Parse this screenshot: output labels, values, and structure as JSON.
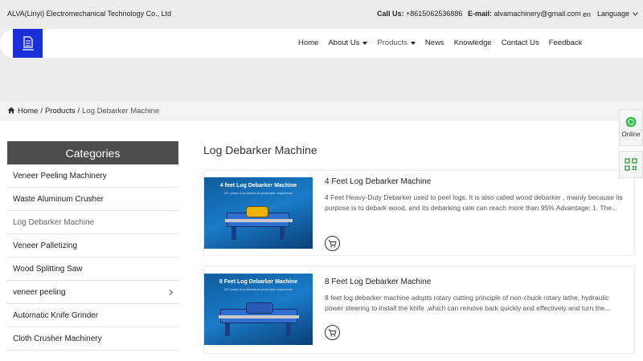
{
  "topbar": {
    "company": "ALVA(Linyi) Electromechanical Technology Co., Ltd",
    "tel_label": "Call Us:",
    "tel_value": "+8615062536886",
    "mail_label": "E-mail:",
    "mail_value": "alvamachinery@gmail.com",
    "lang_code": "en",
    "lang_label": "Language"
  },
  "nav": {
    "items": [
      {
        "label": "Home"
      },
      {
        "label": "About Us"
      },
      {
        "label": "Products"
      },
      {
        "label": "News"
      },
      {
        "label": "Knowledge"
      },
      {
        "label": "Contact Us"
      },
      {
        "label": "Feedback"
      }
    ]
  },
  "breadcrumb": {
    "home": "Home",
    "sep": "/",
    "products": "Products",
    "current": "Log Debarker Machine"
  },
  "sidebar": {
    "title": "Categories",
    "items": [
      {
        "label": "Veneer Peeling Machinery"
      },
      {
        "label": "Waste Aluminum Crusher"
      },
      {
        "label": "Log Debarker Machine"
      },
      {
        "label": "Veneer Palletizing"
      },
      {
        "label": "Wood Splitting Saw"
      },
      {
        "label": "veneer peeling"
      },
      {
        "label": "Automatic Knife Grinder"
      },
      {
        "label": "Cloth Crusher Machinery"
      }
    ]
  },
  "main": {
    "heading": "Log Debarker Machine",
    "products": [
      {
        "thumb_title": "4 feet Log Debarker Machine",
        "thumb_sub": "15+ years of professional production experience",
        "title": "4 Feet Log Debarker Machine",
        "desc": "4 Feet Heavy-Duty Debarker used to peel logs. It is also called wood debarker , mainly because its purpose is to debark wood, and its debarking rate can reach more than 95% Advantage: 1. The..."
      },
      {
        "thumb_title": "8 Feet Log Debarker Machine",
        "thumb_sub": "15+ years of professional production experience",
        "title": "8 Feet Log Debarker Machine",
        "desc": "8 feet log debarker machine adopts rotary cutting principle of  non-chuck rotary lathe, hydraulic power steering to install the knife ,which can remove bark quickly and effectively and turn the..."
      }
    ]
  },
  "floating": {
    "online_label": "Online"
  },
  "colors": {
    "logo_bg": "#1a2fd8",
    "category_header": "#4d4d4d",
    "whatsapp": "#2fbf4a",
    "qr": "#2d9c3a"
  }
}
